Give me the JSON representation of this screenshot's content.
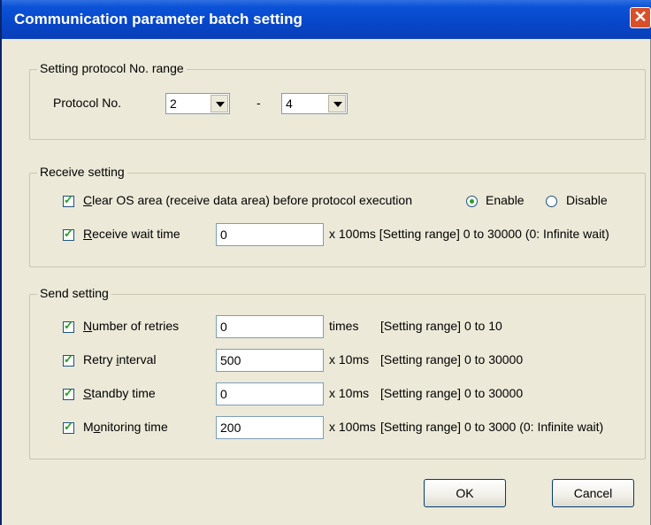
{
  "window": {
    "title": "Communication parameter batch setting",
    "close_glyph": "✕"
  },
  "protocol_range": {
    "group_label": "Setting protocol No. range",
    "protocol_label": "Protocol No.",
    "from_value": "2",
    "separator": "-",
    "to_value": "4"
  },
  "receive": {
    "group_label": "Receive setting",
    "clear_os": {
      "label_pre": "",
      "label_u": "C",
      "label_post": "lear OS area (receive data area) before protocol execution",
      "checked": true,
      "enable_label": "Enable",
      "disable_label": "Disable",
      "selected": "Enable"
    },
    "wait_time": {
      "label_u": "R",
      "label_post": "eceive wait time",
      "checked": true,
      "value": "0",
      "unit_range": "x 100ms [Setting range] 0 to 30000 (0: Infinite wait)"
    }
  },
  "send": {
    "group_label": "Send setting",
    "rows": [
      {
        "label_pre": "",
        "label_u": "N",
        "label_post": "umber of retries",
        "checked": true,
        "value": "0",
        "unit": "times",
        "range": "[Setting range] 0 to 10"
      },
      {
        "label_pre": "Retry ",
        "label_u": "i",
        "label_post": "nterval",
        "checked": true,
        "value": "500",
        "unit": "x 10ms",
        "range": "[Setting range] 0 to 30000"
      },
      {
        "label_pre": "",
        "label_u": "S",
        "label_post": "tandby time",
        "checked": true,
        "value": "0",
        "unit": "x 10ms",
        "range": "[Setting range] 0 to 30000"
      },
      {
        "label_pre": "M",
        "label_u": "o",
        "label_post": "nitoring time",
        "checked": true,
        "value": "200",
        "unit": "x 100ms",
        "range": "[Setting range] 0 to 3000 (0: Infinite wait)"
      }
    ]
  },
  "buttons": {
    "ok": "OK",
    "cancel": "Cancel"
  }
}
